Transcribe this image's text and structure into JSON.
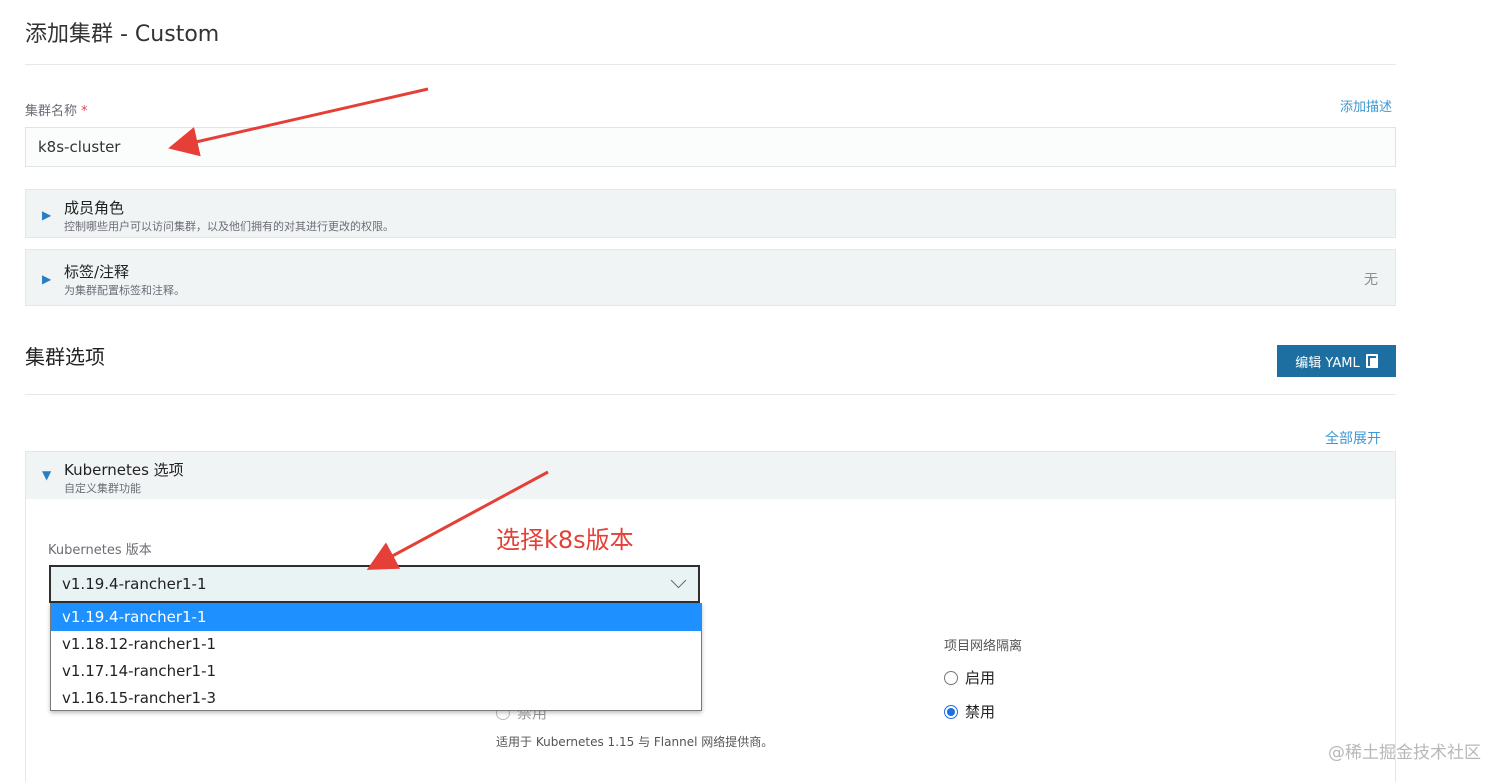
{
  "header": {
    "title": "添加集群 - Custom"
  },
  "cluster_name": {
    "label": "集群名称",
    "required_mark": "*",
    "value": "k8s-cluster",
    "add_description": "添加描述"
  },
  "accordions": {
    "members": {
      "title": "成员角色",
      "desc": "控制哪些用户可以访问集群，以及他们拥有的对其进行更改的权限。"
    },
    "labels": {
      "title": "标签/注释",
      "desc": "为集群配置标签和注释。",
      "status": "无"
    }
  },
  "cluster_options": {
    "title": "集群选项",
    "edit_yaml": "编辑 YAML",
    "expand_all": "全部展开"
  },
  "k8s_options": {
    "title": "Kubernetes 选项",
    "desc": "自定义集群功能",
    "version_label": "Kubernetes 版本",
    "selected_version": "v1.19.4-rancher1-1",
    "versions": [
      "v1.19.4-rancher1-1",
      "v1.18.12-rancher1-1",
      "v1.17.14-rancher1-1",
      "v1.16.15-rancher1-3"
    ],
    "network_hint": "适用于 Kubernetes 1.15 与 Flannel 网络提供商。",
    "partial_disable": "禁用"
  },
  "isolation": {
    "label": "项目网络隔离",
    "enable": "启用",
    "disable": "禁用",
    "selected": "禁用"
  },
  "annotations": {
    "arrow_note": "选择k8s版本"
  },
  "watermark": "@稀土掘金技术社区",
  "colors": {
    "accent": "#1c6fa0",
    "link": "#3d98d3",
    "annotation_red": "#e53f37",
    "selected_option": "#1e90ff"
  }
}
